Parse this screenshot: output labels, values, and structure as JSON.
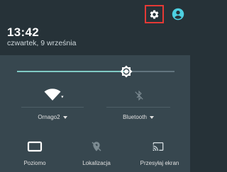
{
  "status": {
    "time": "13:42",
    "date": "czwartek, 9 września"
  },
  "icons": {
    "settings": "gear-icon",
    "user": "account-circle-icon",
    "brightness": "brightness-icon",
    "wifi": "wifi-icon",
    "bluetooth": "bluetooth-icon",
    "rotation": "screen-landscape-icon",
    "location": "location-off-icon",
    "cast": "cast-icon"
  },
  "brightness": {
    "level_percent": 70
  },
  "tiles": {
    "wifi": {
      "label": "Ornago2",
      "state": "on"
    },
    "bluetooth": {
      "label": "Bluetooth",
      "state": "off"
    },
    "rotation": {
      "label": "Poziomo",
      "state": "on"
    },
    "location": {
      "label": "Lokalizacja",
      "state": "off"
    },
    "cast": {
      "label": "Przesyłaj ekran",
      "state": "on"
    }
  },
  "colors": {
    "header_bg": "#263238",
    "panel_bg": "#37474f",
    "accent": "#80cbc4",
    "highlight_border": "#e53935"
  }
}
